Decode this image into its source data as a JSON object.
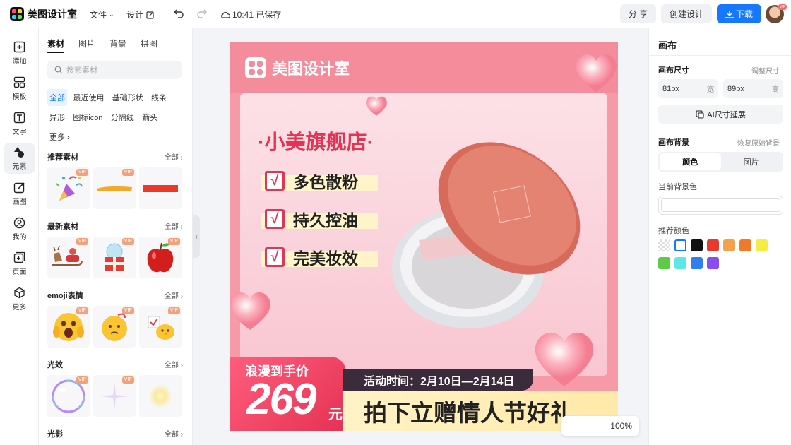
{
  "app": {
    "name": "美图设计室"
  },
  "topbar": {
    "file_menu": "文件",
    "design_menu": "设计",
    "save_status": "10:41 已保存",
    "share_label": "分 享",
    "create_label": "创建设计",
    "download_label": "下载"
  },
  "rail": [
    {
      "label": "添加",
      "icon": "plus-square-icon"
    },
    {
      "label": "模板",
      "icon": "template-icon"
    },
    {
      "label": "文字",
      "icon": "text-icon"
    },
    {
      "label": "元素",
      "icon": "shapes-icon"
    },
    {
      "label": "画图",
      "icon": "draw-icon"
    },
    {
      "label": "我的",
      "icon": "user-icon"
    },
    {
      "label": "页面",
      "icon": "page-add-icon"
    },
    {
      "label": "更多",
      "icon": "cube-icon"
    }
  ],
  "panel": {
    "tabs": [
      "素材",
      "图片",
      "背景",
      "拼图"
    ],
    "search_placeholder": "搜索素材",
    "chips": [
      "全部",
      "最近使用",
      "基础形状",
      "线条",
      "异形",
      "图标icon",
      "分隔线",
      "箭头",
      "更多"
    ],
    "see_all": "全部",
    "vip": "VIP",
    "sections": [
      {
        "title": "推荐素材"
      },
      {
        "title": "最新素材"
      },
      {
        "title": "emoji表情"
      },
      {
        "title": "光效"
      },
      {
        "title": "光影"
      }
    ]
  },
  "canvas": {
    "brand": "美图设计室",
    "store_name": "·小美旗舰店·",
    "check_mark": "√",
    "features": [
      "多色散粉",
      "持久控油",
      "完美妆效"
    ],
    "promo_label": "浪漫到手价",
    "price": "269",
    "currency": "元",
    "date_text": "活动时间：2月10日—2月14日",
    "gift_text": "拍下立赠情人节好礼"
  },
  "zoom": {
    "value": "100%"
  },
  "right_panel": {
    "title": "画布",
    "size_label": "画布尺寸",
    "adjust_size": "调整尺寸",
    "width_value": "81px",
    "width_unit": "宽",
    "height_value": "89px",
    "height_unit": "高",
    "ai_extend": "AI尺寸延展",
    "bg_label": "画布背景",
    "restore_bg": "恢复原始背景",
    "bg_tabs": [
      "颜色",
      "图片"
    ],
    "current_bg_label": "当前背景色",
    "current_bg_color": "#ffffff",
    "recommended_label": "推荐颜色",
    "swatches": [
      "transparent",
      "#ffffff",
      "#111111",
      "#e8392a",
      "#f3a14b",
      "#f07a2a",
      "#f6ec43",
      "#5ccc45",
      "#5de8e8",
      "#2f7ff0",
      "#8a4df0"
    ]
  },
  "colors": {
    "accent": "#1677ff",
    "canvas_bg": "#f59aa6",
    "brand_red": "#e63253"
  }
}
